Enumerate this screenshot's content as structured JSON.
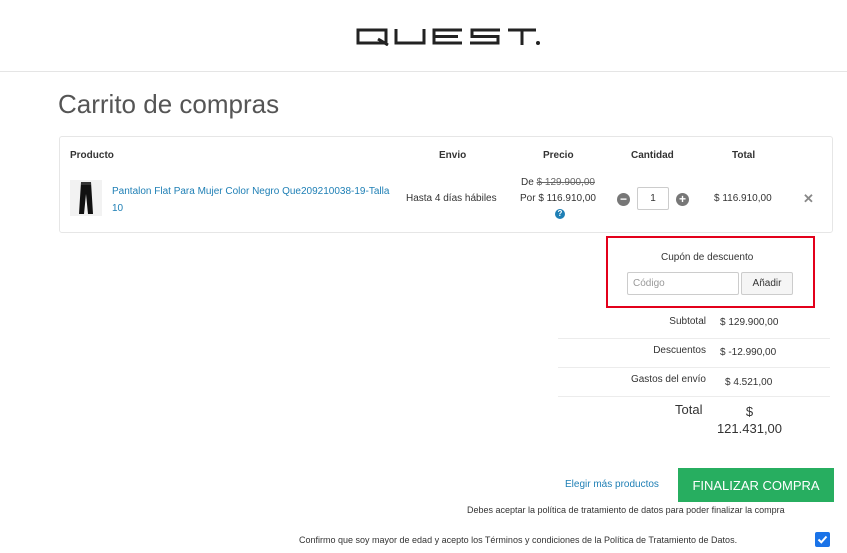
{
  "header": {
    "logo_alt": "QUEST"
  },
  "page": {
    "title": "Carrito de compras"
  },
  "table": {
    "headers": {
      "producto": "Producto",
      "envio": "Envio",
      "precio": "Precio",
      "cantidad": "Cantidad",
      "total": "Total"
    },
    "rows": [
      {
        "name": "Pantalon Flat Para Mujer Color Negro Que209210038-19-Talla 10",
        "shipping": "Hasta 4 días hábiles",
        "price_prefix": "De",
        "price_old": "$ 129.900,00",
        "price_new": "Por $ 116.910,00",
        "quantity": "1",
        "total": "$ 116.910,00"
      }
    ]
  },
  "coupon": {
    "title": "Cupón de descuento",
    "placeholder": "Código",
    "button": "Añadir"
  },
  "summary": {
    "subtotal_label": "Subtotal",
    "subtotal_value": "$ 129.900,00",
    "discount_label": "Descuentos",
    "discount_value": "$ -12.990,00",
    "shipping_label": "Gastos del envío",
    "shipping_value": "$ 4.521,00",
    "total_label": "Total",
    "total_value": "$ 121.431,00"
  },
  "actions": {
    "continue_link": "Elegir más productos",
    "checkout_button": "FINALIZAR COMPRA",
    "policy_note": "Debes aceptar la política de tratamiento de datos para poder finalizar la compra",
    "confirm_text": "Confirmo que soy mayor de edad y acepto los Términos y condiciones de la Política de Tratamiento de Datos."
  },
  "colors": {
    "link": "#1e7fb5",
    "checkout": "#27ae60",
    "highlight": "#e3001b",
    "checkbox": "#1a73e8"
  },
  "icons": {
    "minus": "minus-circle-icon",
    "plus": "plus-circle-icon",
    "help": "question-circle-icon",
    "remove": "close-icon",
    "check": "checkmark-icon"
  }
}
